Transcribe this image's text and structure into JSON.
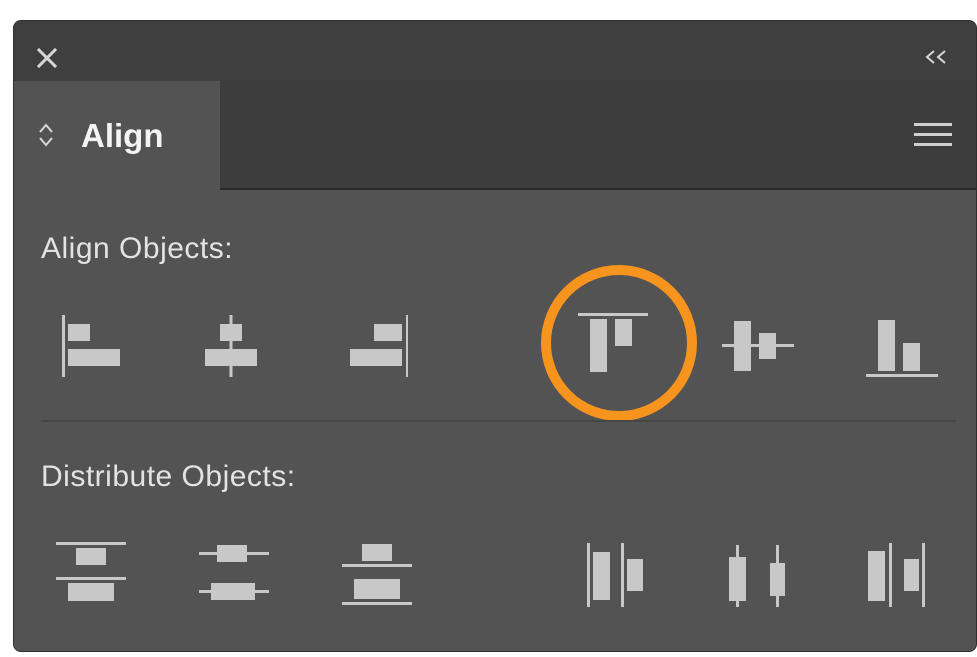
{
  "panel": {
    "title_bar": {
      "close_icon": "close-icon",
      "collapse_icon": "double-chevron-left-icon",
      "collapse_text": "<<"
    },
    "tab": {
      "label": "Align",
      "icon": "up-down-arrows-icon"
    },
    "menu_icon": "hamburger-menu-icon"
  },
  "align_objects": {
    "label": "Align Objects:",
    "tools": [
      {
        "name": "horizontal-align-left",
        "icon": "horizontal-align-left-icon"
      },
      {
        "name": "horizontal-align-center",
        "icon": "horizontal-align-center-icon"
      },
      {
        "name": "horizontal-align-right",
        "icon": "horizontal-align-right-icon"
      },
      {
        "name": "vertical-align-top",
        "icon": "vertical-align-top-icon",
        "highlighted": true
      },
      {
        "name": "vertical-align-center",
        "icon": "vertical-align-center-icon"
      },
      {
        "name": "vertical-align-bottom",
        "icon": "vertical-align-bottom-icon"
      }
    ]
  },
  "distribute_objects": {
    "label": "Distribute Objects:",
    "tools": [
      {
        "name": "vertical-distribute-top",
        "icon": "vertical-distribute-top-icon"
      },
      {
        "name": "vertical-distribute-center",
        "icon": "vertical-distribute-center-icon"
      },
      {
        "name": "vertical-distribute-bottom",
        "icon": "vertical-distribute-bottom-icon"
      },
      {
        "name": "horizontal-distribute-left",
        "icon": "horizontal-distribute-left-icon"
      },
      {
        "name": "horizontal-distribute-center",
        "icon": "horizontal-distribute-center-icon"
      },
      {
        "name": "horizontal-distribute-right",
        "icon": "horizontal-distribute-right-icon"
      }
    ]
  },
  "colors": {
    "panel_bg": "#535353",
    "titlebar_bg": "#3f3f3f",
    "icon_fill": "#c8c8c8",
    "highlight": "#f7941d"
  }
}
